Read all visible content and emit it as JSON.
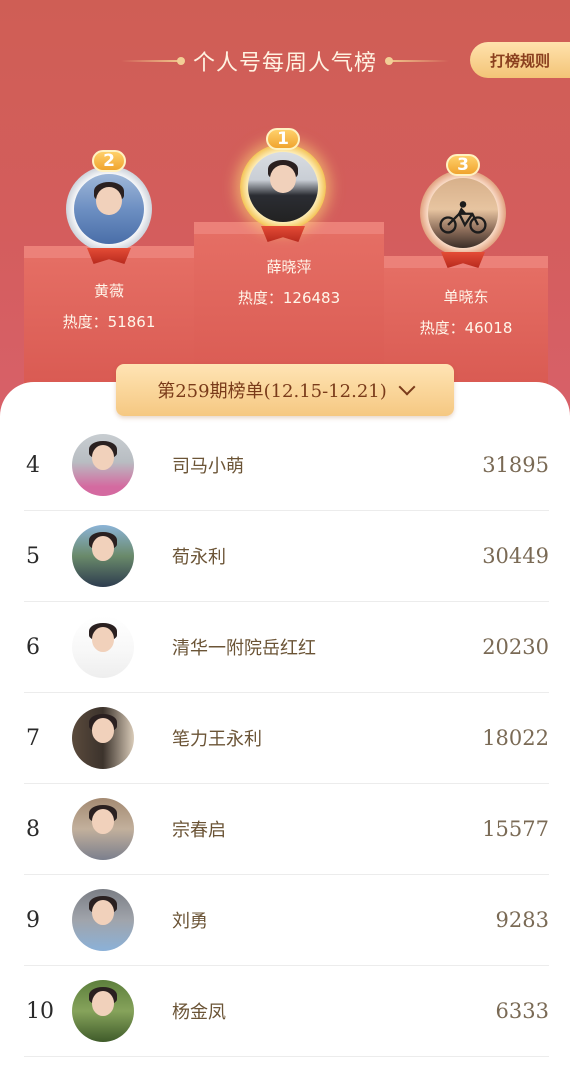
{
  "header": {
    "title": "个人号每周人气榜",
    "rules_button": "打榜规则"
  },
  "podium": [
    {
      "rank": "1",
      "name": "薛晓萍",
      "heat": "热度：126483",
      "score": 126483,
      "medal": "gold"
    },
    {
      "rank": "2",
      "name": "黄薇",
      "heat": "热度：51861",
      "score": 51861,
      "medal": "silver"
    },
    {
      "rank": "3",
      "name": "单晓东",
      "heat": "热度：46018",
      "score": 46018,
      "medal": "bronze"
    }
  ],
  "period": {
    "label": "第259期榜单(12.15-12.21)",
    "icon": "chevron-down-icon"
  },
  "ranking": [
    {
      "rank": "4",
      "name": "司马小萌",
      "score": "31895"
    },
    {
      "rank": "5",
      "name": "荀永利",
      "score": "30449"
    },
    {
      "rank": "6",
      "name": "清华一附院岳红红",
      "score": "20230"
    },
    {
      "rank": "7",
      "name": "笔力王永利",
      "score": "18022"
    },
    {
      "rank": "8",
      "name": "宗春启",
      "score": "15577"
    },
    {
      "rank": "9",
      "name": "刘勇",
      "score": "9283"
    },
    {
      "rank": "10",
      "name": "杨金凤",
      "score": "6333"
    }
  ],
  "colors": {
    "hero_bg": "#d45d5d",
    "accent_gold": "#f5c882",
    "name_text": "#6b5436",
    "score_text": "#7a6a55"
  }
}
